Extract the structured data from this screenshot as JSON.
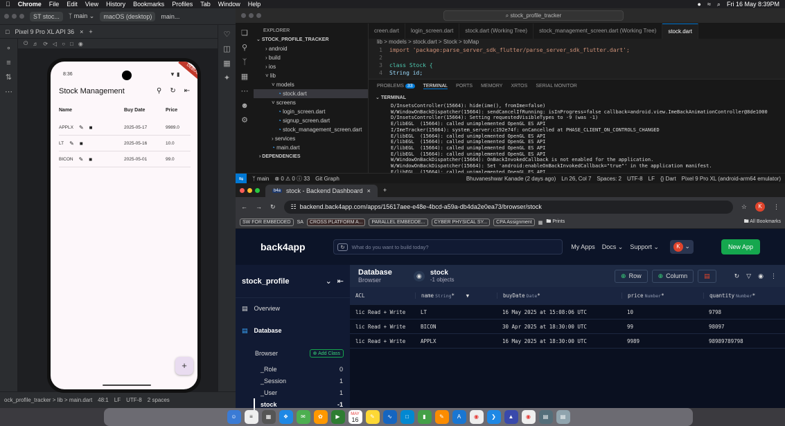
{
  "menubar": {
    "items": [
      "Chrome",
      "File",
      "Edit",
      "View",
      "History",
      "Bookmarks",
      "Profiles",
      "Tab",
      "Window",
      "Help"
    ],
    "clock": "Fri 16 May 8:39PM"
  },
  "android_studio": {
    "project": "ST stoc...",
    "branch": "main",
    "device_select": "macOS (desktop)",
    "run_config": "main...",
    "device_tab": "Pixel 9 Pro XL API 36",
    "status": {
      "breadcrumb": "ock_profile_tracker  >  lib  >  main.dart",
      "position": "48:1",
      "lf": "LF",
      "encoding": "UTF-8",
      "indent": "2 spaces"
    }
  },
  "phone": {
    "time": "8:36",
    "debug": "DEBUG",
    "app_title": "Stock Management",
    "columns": [
      "Name",
      "Buy Date",
      "Price"
    ],
    "rows": [
      {
        "name": "APPLX",
        "date": "2025-05-17",
        "price": "9989.0"
      },
      {
        "name": "LT",
        "date": "2025-05-16",
        "price": "10.0"
      },
      {
        "name": "BICON",
        "date": "2025-05-01",
        "price": "99.0"
      }
    ],
    "fab": "+"
  },
  "vscode": {
    "search": "stock_profile_tracker",
    "explorer_title": "EXPLORER",
    "project": "STOCK_PROFILE_TRACKER",
    "tree": [
      {
        "label": "android",
        "depth": 1,
        "kind": "folder"
      },
      {
        "label": "build",
        "depth": 1,
        "kind": "folder"
      },
      {
        "label": "ios",
        "depth": 1,
        "kind": "folder"
      },
      {
        "label": "lib",
        "depth": 1,
        "kind": "folder-open"
      },
      {
        "label": "models",
        "depth": 2,
        "kind": "folder-open"
      },
      {
        "label": "stock.dart",
        "depth": 3,
        "kind": "file",
        "selected": true
      },
      {
        "label": "screens",
        "depth": 2,
        "kind": "folder-open"
      },
      {
        "label": "login_screen.dart",
        "depth": 3,
        "kind": "file"
      },
      {
        "label": "signup_screen.dart",
        "depth": 3,
        "kind": "file"
      },
      {
        "label": "stock_management_screen.dart",
        "depth": 3,
        "kind": "file"
      },
      {
        "label": "services",
        "depth": 2,
        "kind": "folder"
      },
      {
        "label": "main.dart",
        "depth": 2,
        "kind": "file"
      },
      {
        "label": "DEPENDENCIES",
        "depth": 0,
        "kind": "section"
      }
    ],
    "tabs": [
      "creen.dart",
      "login_screen.dart",
      "stock.dart (Working Tree)",
      "stock_management_screen.dart (Working Tree)",
      "stock.dart"
    ],
    "breadcrumb": "lib > models > stock.dart > Stock > toMap",
    "code": [
      {
        "n": "1",
        "t": "import 'package:parse_server_sdk_flutter/parse_server_sdk_flutter.dart';"
      },
      {
        "n": "2",
        "t": ""
      },
      {
        "n": "3",
        "t": "class Stock {"
      },
      {
        "n": "4",
        "t": "  String id;"
      }
    ],
    "panel_tabs": [
      "PROBLEMS",
      "TERMINAL",
      "PORTS",
      "MEMORY",
      "XRTOS",
      "SERIAL MONITOR"
    ],
    "problems_count": "33",
    "terminal_label": "TERMINAL",
    "terminal": [
      "D/InsetsController(15664): hide(ime(), fromIme=false)",
      "W/WindowOnBackDispatcher(15664): sendCancelIfRunning: isInProgress=false callback=android.view.ImeBackAnimationController@8de1000",
      "D/InsetsController(15664): Setting requestedVisibleTypes to -9 (was -1)",
      "E/libEGL  (15664): called unimplemented OpenGL ES API",
      "I/ImeTracker(15664): system_server:c192e74f: onCancelled at PHASE_CLIENT_ON_CONTROLS_CHANGED",
      "E/libEGL  (15664): called unimplemented OpenGL ES API",
      "E/libEGL  (15664): called unimplemented OpenGL ES API",
      "E/libEGL  (15664): called unimplemented OpenGL ES API",
      "E/libEGL  (15664): called unimplemented OpenGL ES API",
      "W/WindowOnBackDispatcher(15664): OnBackInvokedCallback is not enabled for the application.",
      "W/WindowOnBackDispatcher(15664): Set 'android:enableOnBackInvokedCallback=\"true\"' in the application manifest.",
      "E/libEGL  (15664): called unimplemented OpenGL ES API"
    ],
    "status": {
      "branch": "main",
      "problems": "0 ⚠ 0 ⓘ 33",
      "git": "Git Graph",
      "author": "Bhuvaneshwar Kanade (2 days ago)",
      "pos": "Ln 26, Col 7",
      "spaces": "Spaces: 2",
      "enc": "UTF-8",
      "lf": "LF",
      "lang": "{} Dart",
      "device": "Pixel 9 Pro XL (android-arm64 emulator)"
    }
  },
  "chrome": {
    "tab_title": "stock - Backend Dashboard",
    "url": "backend.back4app.com/apps/15617aee-e48e-4bcd-a59a-db4da2e0ea73/browser/stock",
    "profile": "K",
    "bookmarks": [
      "SW FOR EMBEDDED",
      "SA",
      "CROSS PLATFORM A...",
      "PARALLEL EMBEDDE...",
      "CYBER PHYSICAL SY...",
      "CPA Assignment"
    ],
    "prints": "Prints",
    "all_bookmarks": "All Bookmarks"
  },
  "back4app": {
    "logo": "back4app",
    "ask_placeholder": "What do you want to build today?",
    "nav": [
      "My Apps",
      "Docs",
      "Support"
    ],
    "avatar": "K",
    "new_app": "New App",
    "app_name": "stock_profile",
    "side": {
      "overview": "Overview",
      "database": "Database",
      "browser": "Browser",
      "add_class": "Add Class",
      "classes": [
        {
          "name": "_Role",
          "count": "0"
        },
        {
          "name": "_Session",
          "count": "1"
        },
        {
          "name": "_User",
          "count": "1"
        },
        {
          "name": "stock",
          "count": "-1"
        }
      ]
    },
    "toolbar": {
      "section": "Database",
      "sub": "Browser",
      "class": "stock",
      "objects": "-1 objects",
      "row": "Row",
      "column": "Column"
    },
    "columns": [
      {
        "name": "ACL",
        "type": ""
      },
      {
        "name": "name",
        "type": "String"
      },
      {
        "name": "buyDate",
        "type": "Date"
      },
      {
        "name": "price",
        "type": "Number"
      },
      {
        "name": "quantity",
        "type": "Number"
      }
    ],
    "rows": [
      {
        "acl": "lic Read + Write",
        "name": "LT",
        "date": "16 May 2025 at 15:08:06 UTC",
        "price": "10",
        "qty": "9798"
      },
      {
        "acl": "lic Read + Write",
        "name": "BICON",
        "date": "30 Apr 2025 at 18:30:00 UTC",
        "price": "99",
        "qty": "98097"
      },
      {
        "acl": "lic Read + Write",
        "name": "APPLX",
        "date": "16 May 2025 at 18:30:00 UTC",
        "price": "9989",
        "qty": "98989789798"
      }
    ]
  },
  "dock": {
    "calendar_month": "MAY",
    "calendar_day": "16"
  }
}
